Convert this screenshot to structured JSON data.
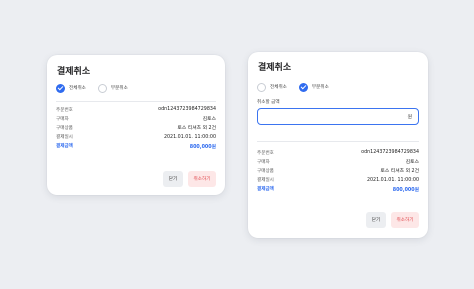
{
  "left": {
    "title": "결제취소",
    "options": {
      "full": "전체취소",
      "partial": "부분취소",
      "selected": "full"
    },
    "rows": [
      {
        "k": "주문번호",
        "v": "odn1243723984729834"
      },
      {
        "k": "구매자",
        "v": "김토스"
      },
      {
        "k": "구매상품",
        "v": "토스 티셔츠 외 2건"
      },
      {
        "k": "결제일시",
        "v": "2021.01.01. 11:00:00"
      }
    ],
    "total": {
      "k": "결제금액",
      "v": "800,000원"
    },
    "buttons": {
      "close": "닫기",
      "cancel": "취소하기"
    }
  },
  "right": {
    "title": "결제취소",
    "options": {
      "full": "전체취소",
      "partial": "부분취소",
      "selected": "partial"
    },
    "amount_label": "취소할 금액",
    "amount_unit": "원",
    "amount_value": "",
    "rows": [
      {
        "k": "주문번호",
        "v": "odn1243723984729834"
      },
      {
        "k": "구매자",
        "v": "김토스"
      },
      {
        "k": "구매상품",
        "v": "토스 티셔츠 외 2건"
      },
      {
        "k": "결제일시",
        "v": "2021.01.01. 11:00:00"
      }
    ],
    "total": {
      "k": "결제금액",
      "v": "800,000원"
    },
    "buttons": {
      "close": "닫기",
      "cancel": "취소하기"
    }
  },
  "colors": {
    "accent": "#2f6bef",
    "danger": "#e0464b",
    "danger_bg": "#fde7e7"
  }
}
